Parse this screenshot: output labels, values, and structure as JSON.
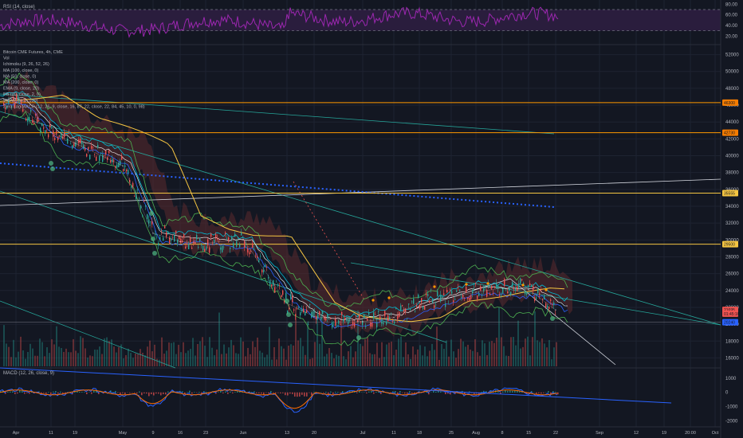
{
  "colors": {
    "background": "#131722",
    "grid": "#1e2331",
    "text": "#b2b5be",
    "up": "#26a69a",
    "down": "#ef5350",
    "rsi": "#9c27b0",
    "rsi_band": "#2a1d3d",
    "support_gold": "#f5c542",
    "orange_line": "#ff9800",
    "blue_dotted": "#2962ff",
    "teal": "#26a69a",
    "white_line": "#d1d4dc",
    "macd": "#2962ff",
    "signal": "#ff6d00",
    "ichimoku_red": "#5b2a2e",
    "ichimoku_green": "#1f4a3f"
  },
  "rsi_panel": {
    "label": "RSI (14, close)",
    "levels": [
      "80.00",
      "60.00",
      "40.00",
      "20.00"
    ]
  },
  "main_panel": {
    "legend": [
      "Bitcoin CME Futures, 4h, CME",
      "Vol",
      "Ichimoku (9, 26, 52, 26)",
      "MA (100, close, 0)",
      "MA (50, close, 0)",
      "MA (200, close, 0)",
      "EMA (9, close, 20)",
      "BB (20, close, 2, 0)",
      "VWAP (hlc3, 100)",
      "Zero Lag MACD (12, 26, 9, close, 16, 87, 22, close, 22, 84, 45, 10, 0, 98)"
    ],
    "price_ticks": [
      "52000",
      "50000",
      "48000",
      "46000",
      "44000",
      "42000",
      "40000",
      "38000",
      "36000",
      "34000",
      "32000",
      "30000",
      "28000",
      "26000",
      "24000",
      "22000",
      "20000",
      "18000",
      "16000"
    ],
    "price_tags": [
      {
        "label": "46300",
        "value": 46300,
        "color": "#f57c00"
      },
      {
        "label": "42730",
        "value": 42730,
        "color": "#f57c00"
      },
      {
        "label": "35555",
        "value": 35555,
        "color": "#f5c542"
      },
      {
        "label": "29500",
        "value": 29500,
        "color": "#f5c542"
      },
      {
        "label": "21695",
        "value": 21695,
        "color": "#ef5350"
      },
      {
        "label": "01:45:16",
        "value": 21250,
        "color": "#ef5350"
      },
      {
        "label": "20240",
        "value": 20240,
        "color": "#2962ff"
      }
    ]
  },
  "macd_panel": {
    "label": "MACD (12, 26, close, 9)",
    "ticks": [
      "1000",
      "0",
      "-1000",
      "-2000"
    ]
  },
  "time_axis": [
    "Apr",
    "11",
    "19",
    "May",
    "9",
    "16",
    "23",
    "Jun",
    "13",
    "20",
    "Jul",
    "11",
    "18",
    "25",
    "Aug",
    "8",
    "15",
    "22",
    "Sep",
    "12",
    "19",
    "20:00",
    "Oct"
  ],
  "chart_data": {
    "type": "line",
    "title": "Bitcoin CME Futures, 4h, CME",
    "x": [
      "Apr",
      "11",
      "19",
      "May",
      "9",
      "16",
      "23",
      "Jun",
      "13",
      "20",
      "Jul",
      "11",
      "18",
      "25",
      "Aug",
      "8",
      "15",
      "22"
    ],
    "series": [
      {
        "name": "Bitcoin CME Futures, 4h, CME",
        "values": [
          46300,
          42800,
          41500,
          38800,
          30800,
          29800,
          29600,
          30100,
          22500,
          20900,
          20300,
          20800,
          22700,
          23200,
          23800,
          24300,
          24100,
          21695
        ]
      }
    ],
    "ylim": [
      15000,
      53000
    ],
    "horizontal_levels": [
      46300,
      42730,
      35555,
      29500
    ],
    "current_price": 21695,
    "rsi_ylim": [
      10,
      85
    ],
    "macd_ylim": [
      -2300,
      1600
    ]
  }
}
